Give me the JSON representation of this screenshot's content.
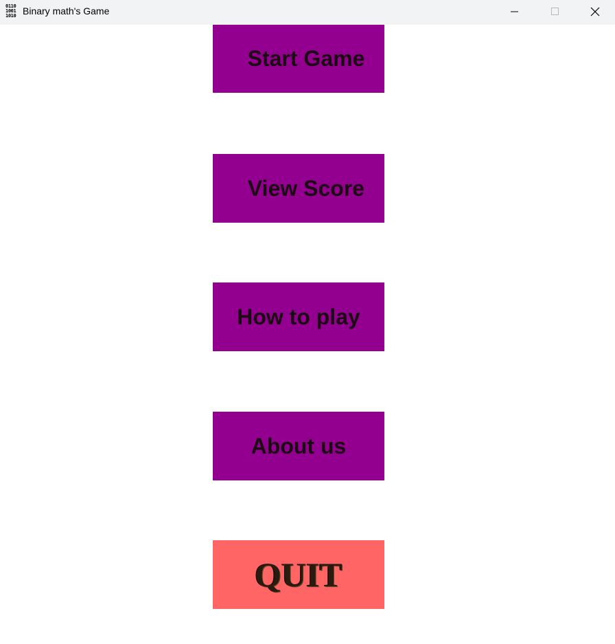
{
  "window": {
    "title": "Binary math's Game",
    "icon": {
      "name": "binary-icon",
      "lines": [
        "0110",
        "1001",
        "1010"
      ]
    },
    "controls": {
      "minimize": "minimize-icon",
      "maximize": "maximize-icon",
      "close": "close-icon"
    }
  },
  "menu": {
    "start_label": "Start Game",
    "score_label": "View Score",
    "howto_label": "How to play",
    "about_label": "About us",
    "quit_label": "QUIT"
  },
  "colors": {
    "menu_button_bg": "#93008f",
    "quit_button_bg": "#ff6565",
    "titlebar_bg": "#f2f3f5"
  }
}
